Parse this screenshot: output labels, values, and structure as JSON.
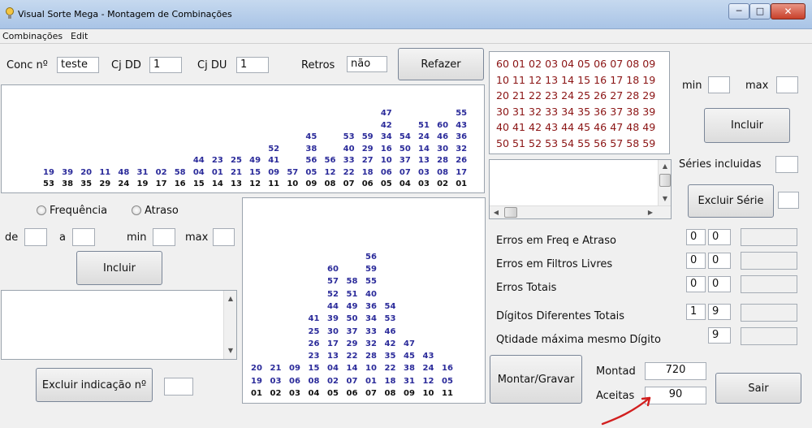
{
  "window": {
    "title": "Visual Sorte Mega - Montagem de Combinações",
    "min": "─",
    "max": "□",
    "close": "✕"
  },
  "menu": [
    "Combinações",
    "Edit"
  ],
  "top": {
    "conc_label": "Conc nº",
    "conc_value": "teste",
    "cjdd_label": "Cj DD",
    "cjdd_value": "1",
    "cjdu_label": "Cj DU",
    "cjdu_value": "1",
    "retros_label": "Retros",
    "retros_value": "não",
    "refazer": "Refazer"
  },
  "freq_chart": {
    "base": [
      "53",
      "38",
      "35",
      "29",
      "24",
      "19",
      "17",
      "16",
      "15",
      "14",
      "13",
      "12",
      "11",
      "10",
      "09",
      "08",
      "07",
      "06",
      "05",
      "04",
      "03",
      "02",
      "01"
    ],
    "stacks": [
      [
        "19"
      ],
      [
        "39"
      ],
      [
        "20"
      ],
      [
        "11"
      ],
      [
        "48"
      ],
      [
        "31"
      ],
      [
        "02"
      ],
      [
        "58"
      ],
      [
        "04",
        "44"
      ],
      [
        "01",
        "23"
      ],
      [
        "21",
        "25"
      ],
      [
        "15",
        "49"
      ],
      [
        "09",
        "41",
        "52"
      ],
      [
        "57"
      ],
      [
        "05",
        "56",
        "38",
        "45"
      ],
      [
        "12",
        "56"
      ],
      [
        "22",
        "33",
        "40",
        "53"
      ],
      [
        "18",
        "27",
        "29",
        "59"
      ],
      [
        "06",
        "10",
        "16",
        "34",
        "42",
        "47"
      ],
      [
        "07",
        "37",
        "50",
        "54"
      ],
      [
        "03",
        "13",
        "14",
        "24",
        "51"
      ],
      [
        "08",
        "28",
        "30",
        "46",
        "60"
      ],
      [
        "17",
        "26",
        "32",
        "36",
        "43",
        "55"
      ]
    ]
  },
  "options": {
    "frequencia": "Frequência",
    "atraso": "Atraso"
  },
  "range": {
    "de": "de",
    "a": "a",
    "min": "min",
    "max": "max"
  },
  "incluir_left": "Incluir",
  "excluir_indicacao": "Excluir indicação nº",
  "atraso_chart": {
    "base": [
      "01",
      "02",
      "03",
      "04",
      "05",
      "06",
      "07",
      "08",
      "09",
      "10",
      "11"
    ],
    "stacks": [
      [
        "19",
        "20"
      ],
      [
        "03",
        "21"
      ],
      [
        "06",
        "09"
      ],
      [
        "08",
        "15",
        "23",
        "26",
        "25",
        "41"
      ],
      [
        "02",
        "04",
        "13",
        "17",
        "30",
        "39",
        "44",
        "52",
        "57",
        "60"
      ],
      [
        "07",
        "14",
        "22",
        "29",
        "37",
        "50",
        "49",
        "51",
        "58"
      ],
      [
        "01",
        "10",
        "28",
        "32",
        "33",
        "34",
        "36",
        "40",
        "55",
        "59",
        "56"
      ],
      [
        "18",
        "22",
        "35",
        "42",
        "46",
        "53",
        "54"
      ],
      [
        "31",
        "38",
        "45",
        "47"
      ],
      [
        "12",
        "24",
        "43"
      ],
      [
        "05",
        "16"
      ]
    ]
  },
  "number_grid": [
    "60 01 02 03 04 05 06 07 08 09",
    "10 11 12 13 14 15 16 17 18 19",
    "20 21 22 23 24 25 26 27 28 29",
    "30 31 32 33 34 35 36 37 38 39",
    "40 41 42 43 44 45 46 47 48 49",
    "50 51 52 53 54 55 56 57 58 59"
  ],
  "right": {
    "min": "min",
    "max": "max",
    "incluir": "Incluir",
    "series_incluidas": "Séries incluidas",
    "excluir_serie": "Excluir Série",
    "erros_freq": {
      "label": "Erros em Freq e Atraso",
      "a": "0",
      "b": "0"
    },
    "erros_filtros": {
      "label": "Erros em Filtros Livres",
      "a": "0",
      "b": "0"
    },
    "erros_totais": {
      "label": "Erros Totais",
      "a": "0",
      "b": "0"
    },
    "digitos": {
      "label": "Dígitos Diferentes Totais",
      "a": "1",
      "b": "9"
    },
    "qtidade": {
      "label": "Qtidade máxima mesmo Dígito",
      "b": "9"
    },
    "montar": "Montar/Gravar",
    "montad_label": "Montad",
    "montad_value": "720",
    "aceitas_label": "Aceitas",
    "aceitas_value": "90",
    "sair": "Sair"
  }
}
